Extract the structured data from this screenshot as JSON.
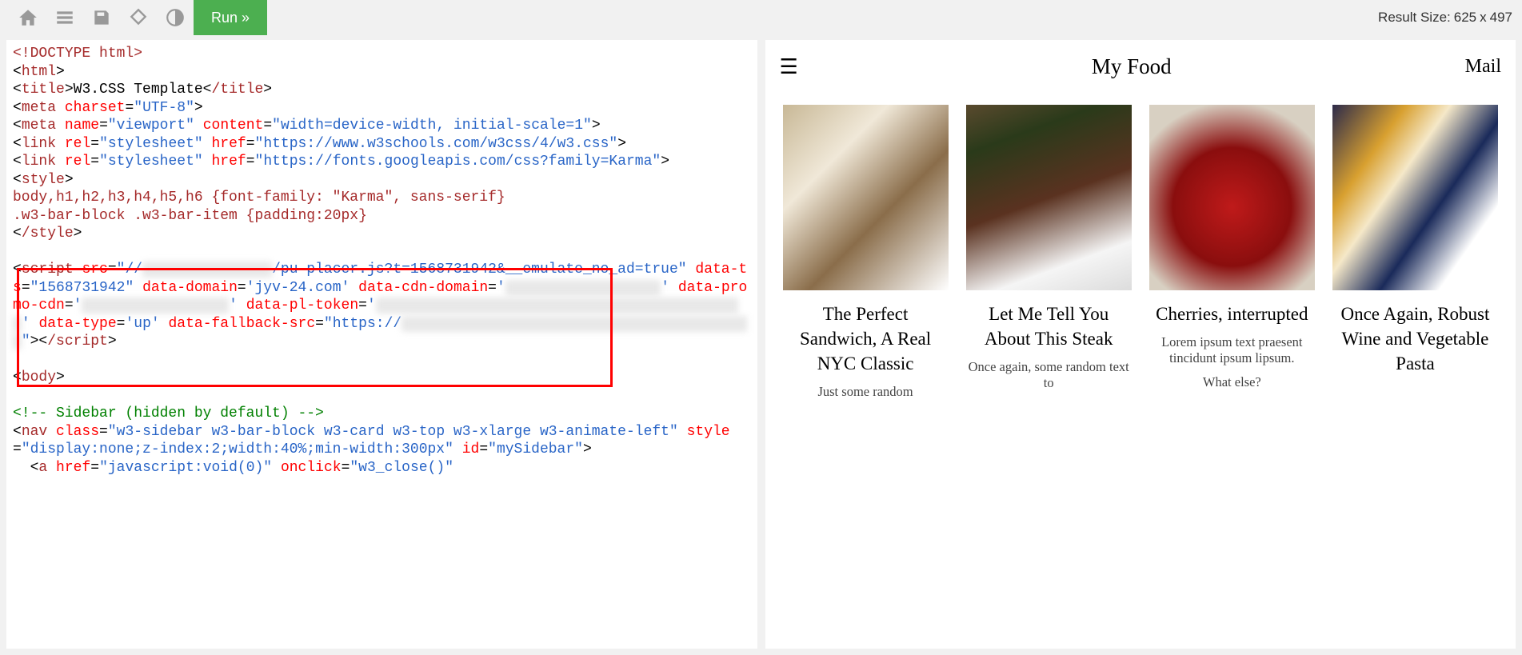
{
  "toolbar": {
    "run_label": "Run »",
    "result_label": "Result Size:",
    "result_w": "625",
    "result_sep": "x",
    "result_h": "497"
  },
  "code": {
    "doctype": "<!DOCTYPE html>",
    "html_open": "html",
    "title_open": "title",
    "title_text": "W3.CSS Template",
    "title_close": "/title",
    "meta1_attr_charset": "charset",
    "meta1_val_charset": "\"UTF-8\"",
    "meta2_attr_name": "name",
    "meta2_val_name": "\"viewport\"",
    "meta2_attr_content": "content",
    "meta2_val_content": "\"width=device-width, initial-scale=1\"",
    "link1_attr_rel": "rel",
    "link1_val_rel": "\"stylesheet\"",
    "link1_attr_href": "href",
    "link1_val_href": "\"https://www.w3schools.com/w3css/4/w3.css\"",
    "link2_attr_rel": "rel",
    "link2_val_rel": "\"stylesheet\"",
    "link2_attr_href": "href",
    "link2_val_href": "\"https://fonts.googleapis.com/css?family=Karma\"",
    "style_open": "style",
    "style_body": "body,h1,h2,h3,h4,h5,h6 {font-family: \"Karma\", sans-serif}\n.w3-bar-block .w3-bar-item {padding:20px}",
    "style_close": "/style",
    "scr_attr_src": "src",
    "scr_val_src_pre": "\"//",
    "scr_blur1": "xxxxxxxxxxxxxxx",
    "scr_val_src_mid": "/pu-placer.js?t=1568731942&__emulate_no_ad=true\"",
    "scr_attr_ts": "data-ts",
    "scr_val_ts": "\"1568731942\"",
    "scr_attr_domain": "data-domain",
    "scr_val_domain": "'jyv-24.com'",
    "scr_attr_cdn": "data-cdn-domain",
    "scr_val_cdn_q": "'",
    "scr_blur2": "xxxxxxxxxxxxxxxxxx",
    "scr_attr_promocdn": "data-promo-cdn",
    "scr_blur3": "xxxxxxxxxxxxxxxxx",
    "scr_attr_pltoken": "data-pl-token",
    "scr_blur4": "xxxxxxxxxxxxxxxxxxxxxxxxxxxxxxxxxxxxxxxxxxx",
    "scr_attr_type": "data-type",
    "scr_val_type": "'up'",
    "scr_attr_fallback": "data-fallback-src",
    "scr_val_fallback_pre": "\"https://",
    "scr_blur5": "xxxxxxxxxxxxxxxxxxxxxxxxxxxxxxxxxxxxxxxxx",
    "scr_val_fallback_post": "\"",
    "script_close": "/script",
    "body_open": "body",
    "comment": "<!-- Sidebar (hidden by default) -->",
    "nav_attr_class": "class",
    "nav_val_class": "\"w3-sidebar w3-bar-block w3-card w3-top w3-xlarge w3-animate-left\"",
    "nav_attr_style": "style",
    "nav_val_style": "\"display:none;z-index:2;width:40%;min-width:300px\"",
    "nav_attr_id": "id",
    "nav_val_id": "\"mySidebar\"",
    "a_attr_href": "href",
    "a_val_href": "\"javascript:void(0)\"",
    "a_attr_onclick": "onclick",
    "a_val_onclick": "\"w3_close()\""
  },
  "preview": {
    "burger": "☰",
    "title": "My Food",
    "mail": "Mail",
    "cards": [
      {
        "title": "The Perfect Sandwich, A Real NYC Classic",
        "text": "Just some random"
      },
      {
        "title": "Let Me Tell You About This Steak",
        "text": "Once again, some random text to"
      },
      {
        "title": "Cherries, interrupted",
        "text": "Lorem ipsum text praesent tincidunt ipsum lipsum.",
        "extra": "What else?"
      },
      {
        "title": "Once Again, Robust Wine and Vegetable Pasta",
        "text": ""
      }
    ]
  }
}
